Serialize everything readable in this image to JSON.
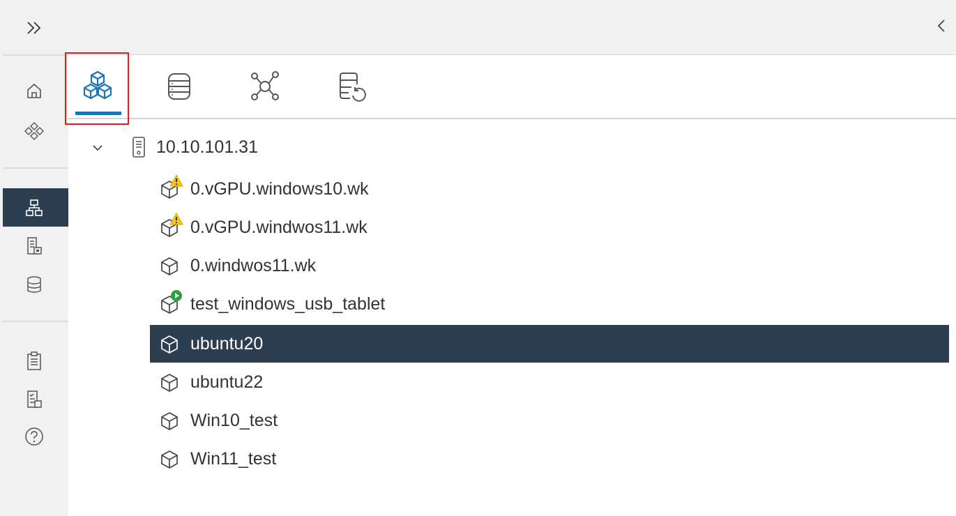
{
  "rail": {
    "items": [
      {
        "name": "home-icon"
      },
      {
        "name": "shortcuts-icon"
      },
      {
        "name": "hosts-and-clusters-icon",
        "active": true
      },
      {
        "name": "vms-and-templates-icon"
      },
      {
        "name": "storage-icon"
      },
      {
        "name": "policies-icon"
      },
      {
        "name": "tasks-icon"
      },
      {
        "name": "help-icon"
      }
    ],
    "active_color": "#2c3e50"
  },
  "tabs": [
    {
      "name": "hosts-and-clusters-tab-icon",
      "selected": true
    },
    {
      "name": "storage-tab-icon"
    },
    {
      "name": "networking-tab-icon"
    },
    {
      "name": "content-libraries-tab-icon"
    }
  ],
  "tree": {
    "host": "10.10.101.31",
    "vms": [
      {
        "label": "0.vGPU.windows10.wk",
        "status": "warning"
      },
      {
        "label": "0.vGPU.windwos11.wk",
        "status": "warning"
      },
      {
        "label": "0.windwos11.wk",
        "status": "none"
      },
      {
        "label": "test_windows_usb_tablet",
        "status": "running"
      },
      {
        "label": "ubuntu20",
        "status": "none",
        "selected": true
      },
      {
        "label": "ubuntu22",
        "status": "none"
      },
      {
        "label": "Win10_test",
        "status": "none"
      },
      {
        "label": "Win11_test",
        "status": "none"
      }
    ]
  },
  "colors": {
    "accent": "#1a73b5",
    "selected_bg": "#2c3e50",
    "warning": "#f5c518",
    "running": "#2e9e3a",
    "highlight": "#e01b1b"
  }
}
